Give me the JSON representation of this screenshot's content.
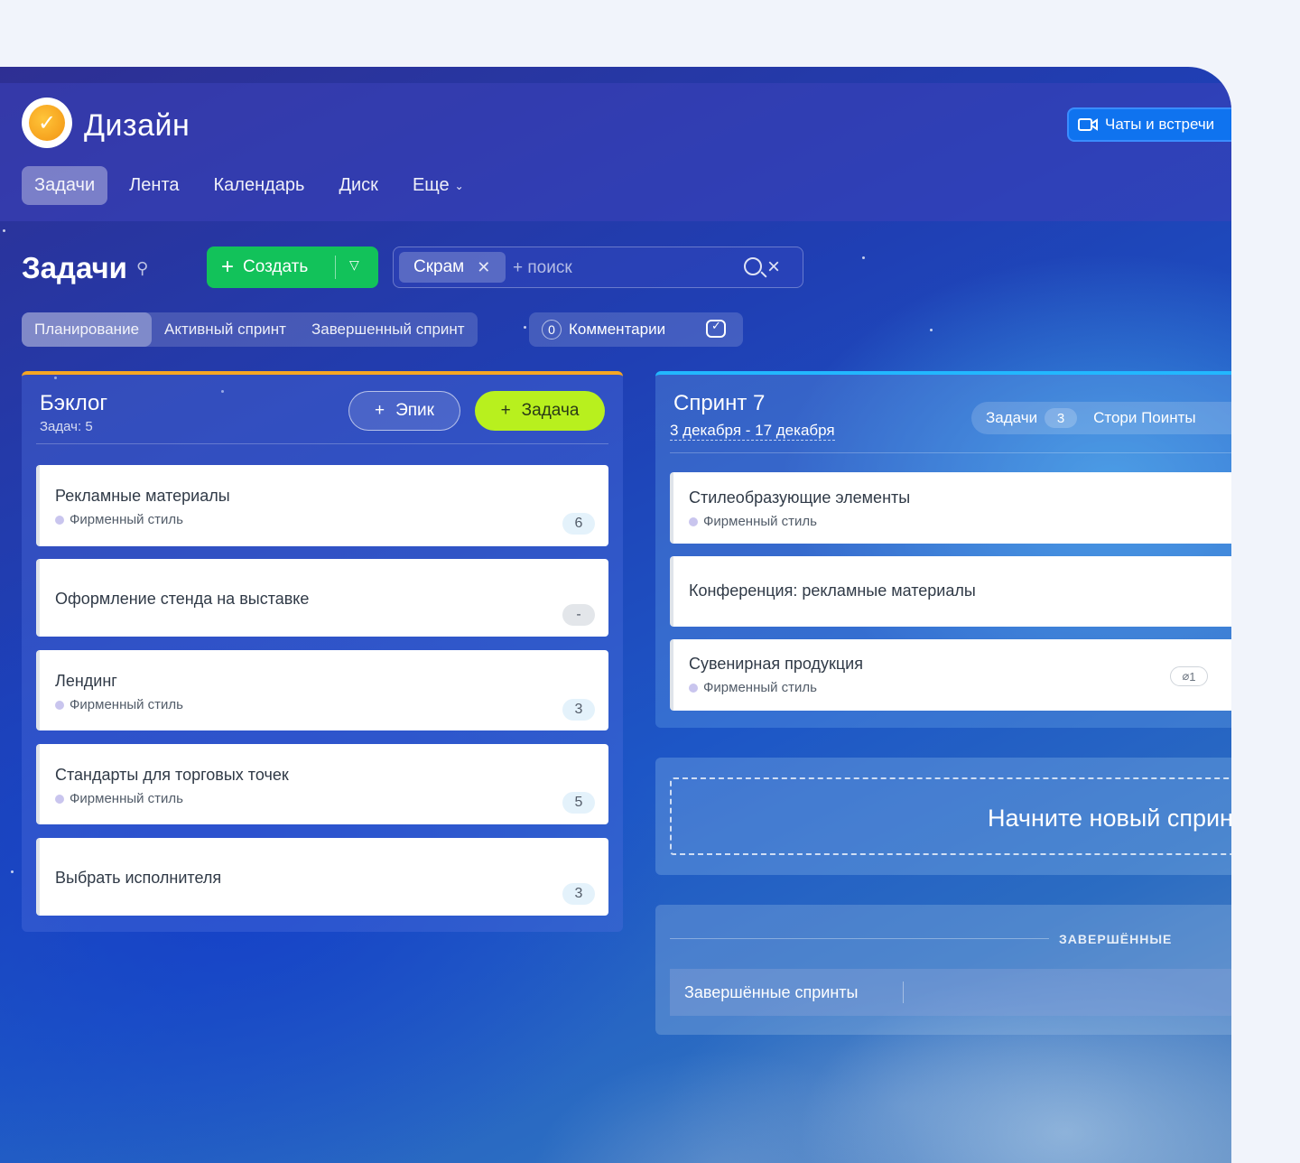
{
  "app": {
    "title": "Дизайн",
    "chats_label": "Чаты и встречи"
  },
  "nav": [
    {
      "label": "Задачи",
      "active": true
    },
    {
      "label": "Лента"
    },
    {
      "label": "Календарь"
    },
    {
      "label": "Диск"
    },
    {
      "label": "Еще"
    }
  ],
  "toolbar": {
    "page_title": "Задачи",
    "create_label": "Создать",
    "filter_chip": "Скрам",
    "search_placeholder": "+ поиск"
  },
  "tabs": [
    {
      "label": "Планирование",
      "active": true
    },
    {
      "label": "Активный спринт"
    },
    {
      "label": "Завершенный спринт"
    }
  ],
  "comments": {
    "count": "0",
    "label": "Комментарии"
  },
  "backlog": {
    "title": "Бэклог",
    "subtitle": "Задач: 5",
    "epic_button": "Эпик",
    "task_button": "Задача",
    "accent": "#f5a623",
    "cards": [
      {
        "title": "Рекламные материалы",
        "epic": "Фирменный стиль",
        "points": "6"
      },
      {
        "title": "Оформление стенда на выставке",
        "epic": "",
        "points": "-"
      },
      {
        "title": "Лендинг",
        "epic": "Фирменный стиль",
        "points": "3"
      },
      {
        "title": "Стандарты для торговых точек",
        "epic": "Фирменный стиль",
        "points": "5"
      },
      {
        "title": "Выбрать исполнителя",
        "epic": "",
        "points": "3"
      }
    ]
  },
  "sprint": {
    "title": "Спринт 7",
    "dates": "3 декабря - 17 декабря",
    "tasks_label": "Задачи",
    "tasks_count": "3",
    "points_label": "Стори Поинты",
    "accent": "#22b7ff",
    "cards": [
      {
        "title": "Стилеобразующие элементы",
        "epic": "Фирменный стиль"
      },
      {
        "title": "Конференция: рекламные материалы",
        "epic": ""
      },
      {
        "title": "Сувенирная продукция",
        "epic": "Фирменный стиль",
        "attachments": "1"
      }
    ]
  },
  "new_sprint": {
    "label": "Начните новый спринт"
  },
  "completed": {
    "section_label": "ЗАВЕРШЁННЫЕ",
    "row_label": "Завершённые спринты"
  }
}
